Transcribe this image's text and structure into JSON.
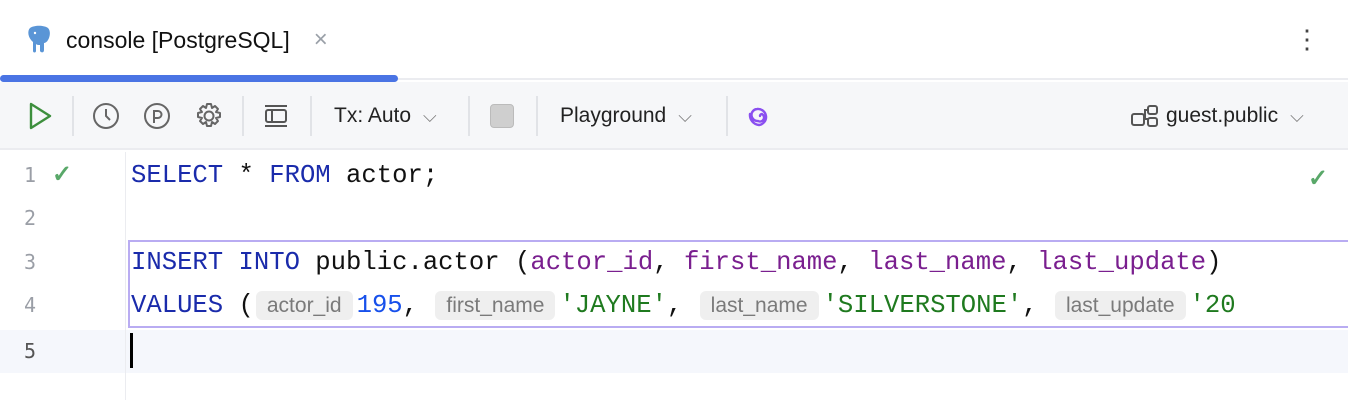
{
  "tab": {
    "title": "console [PostgreSQL]",
    "close": "×",
    "menu": "⋮"
  },
  "toolbar": {
    "tx_label": "Tx: Auto",
    "playground_label": "Playground",
    "schema_label": "guest.public",
    "chevron": "⌵"
  },
  "editor": {
    "line_numbers": [
      "1",
      "2",
      "3",
      "4",
      "5"
    ],
    "line1": {
      "kw1": "SELECT",
      "mid": " * ",
      "kw2": "FROM",
      "rest": " actor;"
    },
    "line3": {
      "kw1": "INSERT",
      "kw2": "INTO",
      "table": " public.actor (",
      "c1": "actor_id",
      "c2": "first_name",
      "c3": "last_name",
      "c4": "last_update",
      "sep": ", ",
      "close": ")"
    },
    "line4": {
      "kw": "VALUES",
      "open": " (",
      "h1": "actor_id",
      "v1": "195",
      "h2": "first_name",
      "v2": "'JAYNE'",
      "h3": "last_name",
      "v3": "'SILVERSTONE'",
      "h4": "last_update",
      "v4": "'20",
      "sep": ", "
    }
  },
  "colors": {
    "accent": "#4a74e4",
    "keyword": "#1a2bab",
    "column": "#7a1f8f",
    "string": "#1f7a1f",
    "ok": "#59a869"
  }
}
